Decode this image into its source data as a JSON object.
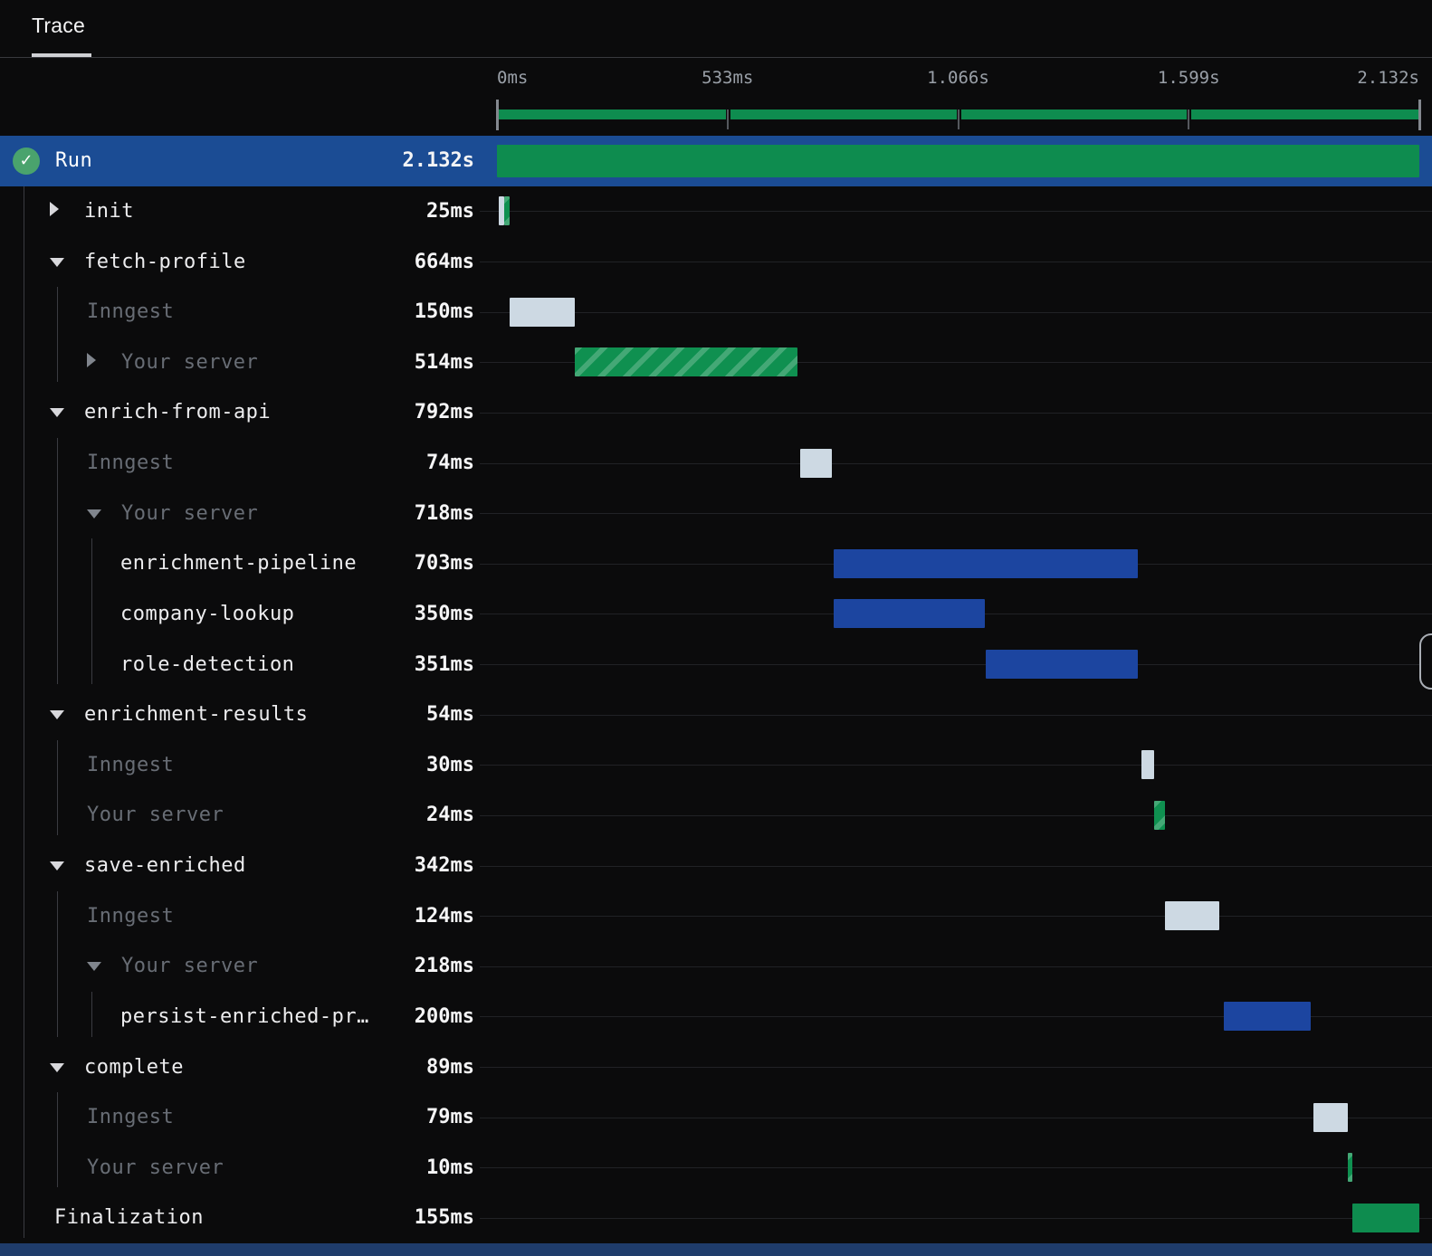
{
  "tab": {
    "label": "Trace"
  },
  "timeline": {
    "total_ms": 2132,
    "ticks": [
      {
        "label": "0ms",
        "pos": 0
      },
      {
        "label": "533ms",
        "pos": 0.25
      },
      {
        "label": "1.066s",
        "pos": 0.5
      },
      {
        "label": "1.599s",
        "pos": 0.75
      },
      {
        "label": "2.132s",
        "pos": 1
      }
    ]
  },
  "run": {
    "label": "Run",
    "duration": "2.132s",
    "status": "success"
  },
  "spans": [
    {
      "label": "init",
      "duration": "25ms",
      "level": 1,
      "tone": "white",
      "arrow": "collapsed",
      "bars": [
        {
          "start": 5,
          "dur": 12,
          "kind": "inngest"
        },
        {
          "start": 17,
          "dur": 13,
          "kind": "server"
        }
      ]
    },
    {
      "label": "fetch-profile",
      "duration": "664ms",
      "level": 1,
      "tone": "white",
      "arrow": "expanded",
      "bars": []
    },
    {
      "label": "Inngest",
      "duration": "150ms",
      "level": 2,
      "tone": "gray",
      "arrow": null,
      "bars": [
        {
          "start": 30,
          "dur": 150,
          "kind": "inngest"
        }
      ]
    },
    {
      "label": "Your server",
      "duration": "514ms",
      "level": 2,
      "tone": "gray",
      "arrow": "collapsed",
      "bars": [
        {
          "start": 180,
          "dur": 514,
          "kind": "server"
        }
      ]
    },
    {
      "label": "enrich-from-api",
      "duration": "792ms",
      "level": 1,
      "tone": "white",
      "arrow": "expanded",
      "bars": []
    },
    {
      "label": "Inngest",
      "duration": "74ms",
      "level": 2,
      "tone": "gray",
      "arrow": null,
      "bars": [
        {
          "start": 700,
          "dur": 74,
          "kind": "inngest"
        }
      ]
    },
    {
      "label": "Your server",
      "duration": "718ms",
      "level": 2,
      "tone": "gray",
      "arrow": "expanded",
      "bars": []
    },
    {
      "label": "enrichment-pipeline",
      "duration": "703ms",
      "level": 3,
      "tone": "white",
      "arrow": null,
      "bars": [
        {
          "start": 778,
          "dur": 703,
          "kind": "step"
        }
      ]
    },
    {
      "label": "company-lookup",
      "duration": "350ms",
      "level": 3,
      "tone": "white",
      "arrow": null,
      "bars": [
        {
          "start": 778,
          "dur": 350,
          "kind": "step"
        }
      ]
    },
    {
      "label": "role-detection",
      "duration": "351ms",
      "level": 3,
      "tone": "white",
      "arrow": null,
      "bars": [
        {
          "start": 1130,
          "dur": 351,
          "kind": "step"
        }
      ]
    },
    {
      "label": "enrichment-results",
      "duration": "54ms",
      "level": 1,
      "tone": "white",
      "arrow": "expanded",
      "bars": []
    },
    {
      "label": "Inngest",
      "duration": "30ms",
      "level": 2,
      "tone": "gray",
      "arrow": null,
      "bars": [
        {
          "start": 1490,
          "dur": 30,
          "kind": "inngest"
        }
      ]
    },
    {
      "label": "Your server",
      "duration": "24ms",
      "level": 2,
      "tone": "gray",
      "arrow": null,
      "bars": [
        {
          "start": 1520,
          "dur": 24,
          "kind": "server"
        }
      ]
    },
    {
      "label": "save-enriched",
      "duration": "342ms",
      "level": 1,
      "tone": "white",
      "arrow": "expanded",
      "bars": []
    },
    {
      "label": "Inngest",
      "duration": "124ms",
      "level": 2,
      "tone": "gray",
      "arrow": null,
      "bars": [
        {
          "start": 1545,
          "dur": 124,
          "kind": "inngest"
        }
      ]
    },
    {
      "label": "Your server",
      "duration": "218ms",
      "level": 2,
      "tone": "gray",
      "arrow": "expanded",
      "bars": []
    },
    {
      "label": "persist-enriched-pr…",
      "duration": "200ms",
      "level": 3,
      "tone": "white",
      "arrow": null,
      "bars": [
        {
          "start": 1680,
          "dur": 200,
          "kind": "step"
        }
      ]
    },
    {
      "label": "complete",
      "duration": "89ms",
      "level": 1,
      "tone": "white",
      "arrow": "expanded",
      "bars": []
    },
    {
      "label": "Inngest",
      "duration": "79ms",
      "level": 2,
      "tone": "gray",
      "arrow": null,
      "bars": [
        {
          "start": 1888,
          "dur": 79,
          "kind": "inngest"
        }
      ]
    },
    {
      "label": "Your server",
      "duration": "10ms",
      "level": 2,
      "tone": "gray",
      "arrow": null,
      "bars": [
        {
          "start": 1967,
          "dur": 10,
          "kind": "server"
        }
      ]
    },
    {
      "label": "Finalization",
      "duration": "155ms",
      "level": 0,
      "tone": "white",
      "arrow": null,
      "bars": [
        {
          "start": 1977,
          "dur": 155,
          "kind": "final"
        }
      ]
    }
  ],
  "colors": {
    "run_row_bg": "#1b4c94",
    "green_bar": "#0e8c4f",
    "green_hatch_bar": "#0f9050",
    "blue_bar": "#1c45a0",
    "inngest_bar": "#cdd9e3",
    "status_icon": "#4aa36d",
    "next_row_strip": "#1f3c6b"
  }
}
